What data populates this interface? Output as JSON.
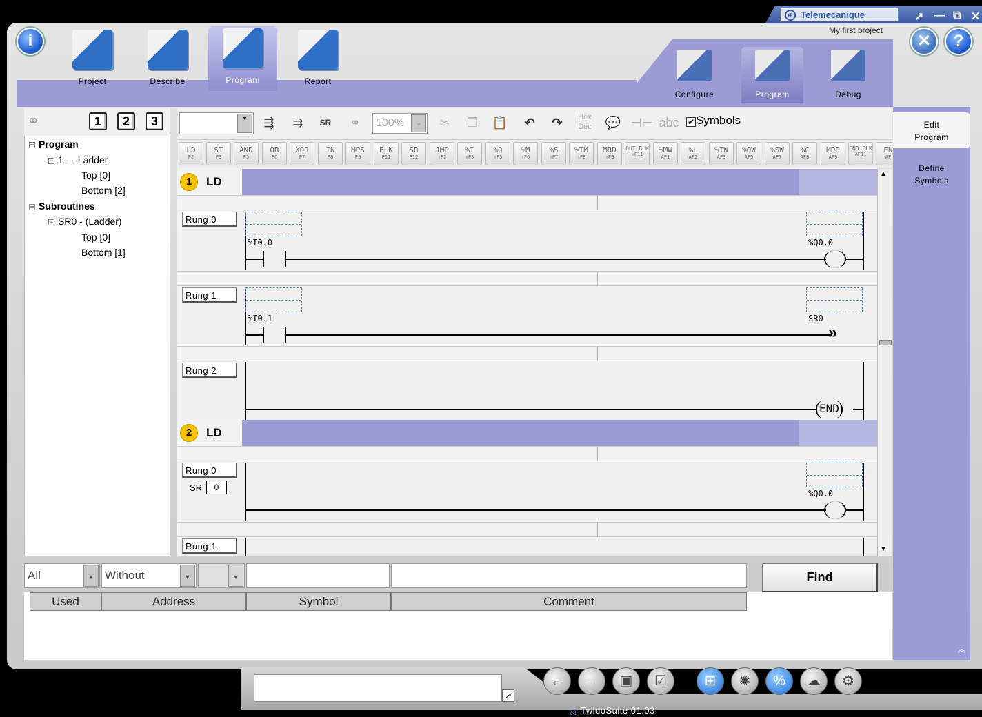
{
  "window": {
    "brand": "Telemecanique",
    "project_name": "My first project",
    "version": "TwidoSuite 01.03"
  },
  "main_tabs": [
    {
      "label": "Project"
    },
    {
      "label": "Describe"
    },
    {
      "label": "Program"
    },
    {
      "label": "Report"
    }
  ],
  "phase_tabs": [
    {
      "label": "Configure"
    },
    {
      "label": "Program"
    },
    {
      "label": "Debug"
    }
  ],
  "side_panel": {
    "edit_program": "Edit\nProgram",
    "define_symbols": "Define\nSymbols"
  },
  "tree": {
    "levels": [
      "1",
      "2",
      "3"
    ],
    "program": "Program",
    "section1": "1 -  - Ladder",
    "top0": "Top [0]",
    "bottom2": "Bottom [2]",
    "subroutines": "Subroutines",
    "sr0": "SR0 -  (Ladder)",
    "sr_top": "Top [0]",
    "sr_bottom": "Bottom [1]"
  },
  "toolbar": {
    "zoom": "100%",
    "hex": "Hex",
    "dec": "Dec",
    "symbols_label": "Symbols",
    "symbols_checked": true
  },
  "instructions": [
    {
      "name": "LD",
      "key": "F2"
    },
    {
      "name": "ST",
      "key": "F3"
    },
    {
      "name": "AND",
      "key": "F5"
    },
    {
      "name": "OR",
      "key": "F6"
    },
    {
      "name": "XOR",
      "key": "F7"
    },
    {
      "name": "IN",
      "key": "F8"
    },
    {
      "name": "MPS",
      "key": "F9"
    },
    {
      "name": "BLK",
      "key": "F11"
    },
    {
      "name": "SR",
      "key": "F12"
    },
    {
      "name": "JMP",
      "key": "⇧F2"
    },
    {
      "name": "%I",
      "key": "⇧F3"
    },
    {
      "name": "%Q",
      "key": "⇧F5"
    },
    {
      "name": "%M",
      "key": "⇧F6"
    },
    {
      "name": "%S",
      "key": "⇧F7"
    },
    {
      "name": "%TM",
      "key": "⇧F8"
    },
    {
      "name": "MRD",
      "key": "⇧F9"
    },
    {
      "name": "OUT BLK",
      "key": "⇧F11"
    },
    {
      "name": "%MW",
      "key": "AF1"
    },
    {
      "name": "%L",
      "key": "AF2"
    },
    {
      "name": "%IW",
      "key": "AF3"
    },
    {
      "name": "%QW",
      "key": "AF5"
    },
    {
      "name": "%SW",
      "key": "AF7"
    },
    {
      "name": "%C",
      "key": "AF8"
    },
    {
      "name": "MPP",
      "key": "AF9"
    },
    {
      "name": "END BLK",
      "key": "AF11"
    },
    {
      "name": "EN",
      "key": "AF"
    }
  ],
  "sections": [
    {
      "num": "1",
      "type": "LD",
      "rungs": [
        {
          "label": "Rung 0",
          "contact": "%I0.0",
          "output": "%Q0.0"
        },
        {
          "label": "Rung 1",
          "contact": "%I0.1",
          "output": "SR0"
        },
        {
          "label": "Rung 2",
          "end": "END"
        }
      ]
    },
    {
      "num": "2",
      "type": "LD",
      "sr_label": "SR",
      "sr_value": "0",
      "rungs": [
        {
          "label": "Rung 0",
          "output": "%Q0.0"
        },
        {
          "label": "Rung 1"
        }
      ]
    }
  ],
  "find": {
    "filter1": "All",
    "filter2": "Without",
    "button": "Find",
    "columns": [
      "Used",
      "Address",
      "Symbol",
      "Comment"
    ]
  }
}
